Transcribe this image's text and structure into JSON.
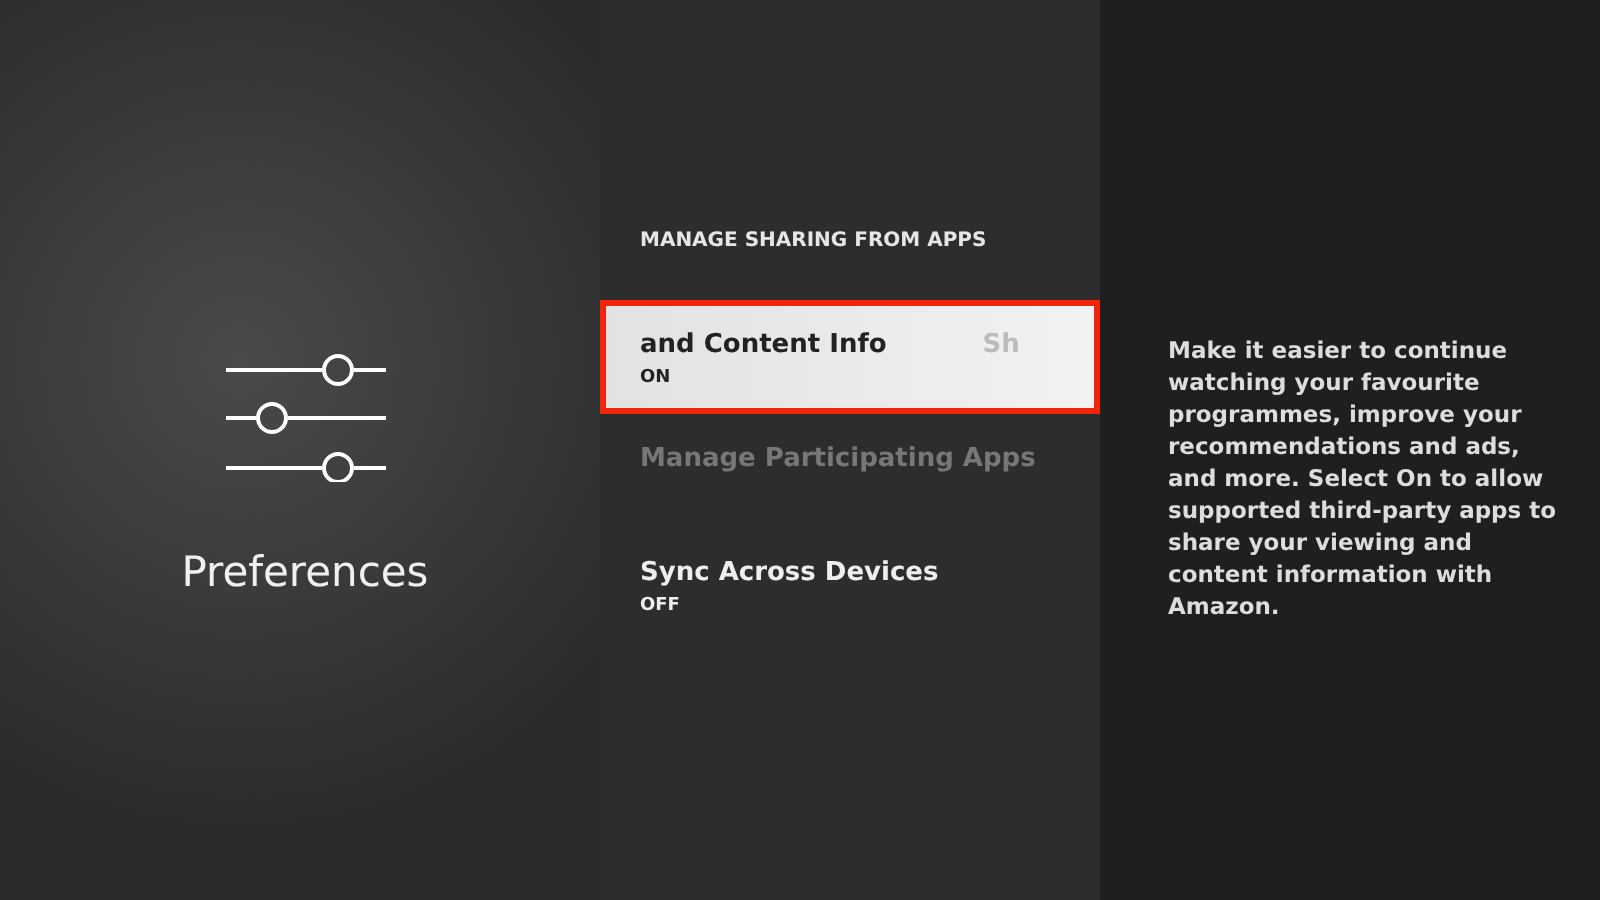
{
  "category": {
    "title": "Preferences"
  },
  "section": {
    "header": "MANAGE SHARING FROM APPS",
    "items": [
      {
        "title": "and Content Info",
        "marquee_tail": "Sh",
        "value": "ON",
        "selected": true,
        "disabled": false
      },
      {
        "title": "Manage Participating Apps",
        "selected": false,
        "disabled": true
      },
      {
        "title": "Sync Across Devices",
        "value": "OFF",
        "selected": false,
        "disabled": false
      }
    ]
  },
  "description": "Make it easier to continue watching your favourite programmes, improve your recommendations and ads, and more. Select On to allow supported third-party apps to share your viewing and content information with Amazon."
}
